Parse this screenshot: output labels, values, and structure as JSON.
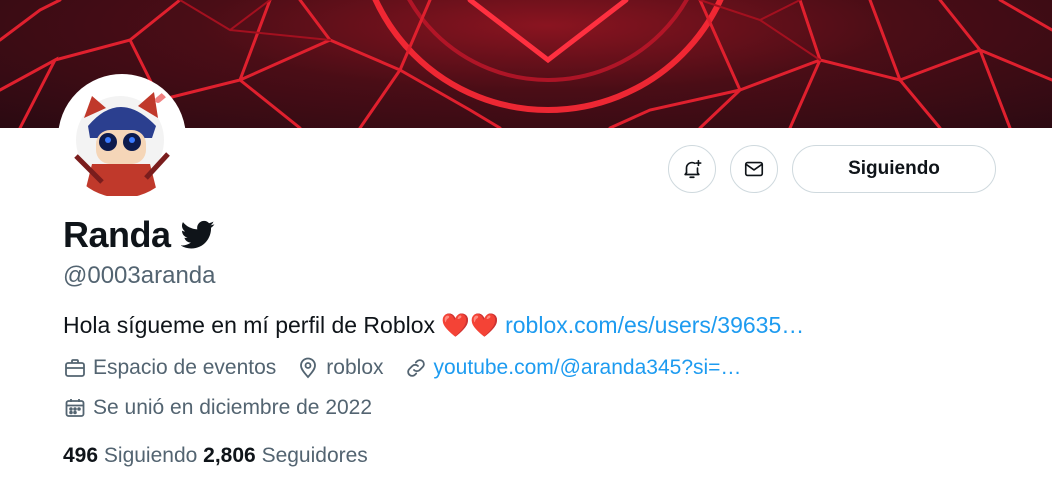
{
  "profile": {
    "name": "Randa",
    "handle": "@0003aranda",
    "bio_text": "Hola sígueme en mí perfil de Roblox ",
    "bio_hearts": "❤️❤️",
    "bio_link": "roblox.com/es/users/39635…",
    "category": "Espacio de eventos",
    "location": "roblox",
    "website": "youtube.com/@aranda345?si=…",
    "joined": "Se unió en diciembre de 2022",
    "following_count": "496",
    "following_label": "Siguiendo",
    "followers_count": "2,806",
    "followers_label": "Seguidores"
  },
  "actions": {
    "follow_label": "Siguiendo"
  },
  "icons": {
    "notify": "bell-plus-icon",
    "message": "envelope-icon",
    "verified_bird": "bird-icon",
    "category": "briefcase-icon",
    "location": "location-pin-icon",
    "website": "link-icon",
    "joined": "calendar-icon"
  },
  "colors": {
    "link": "#1d9bf0",
    "secondary_text": "#536471",
    "banner_red": "#e0202e"
  }
}
